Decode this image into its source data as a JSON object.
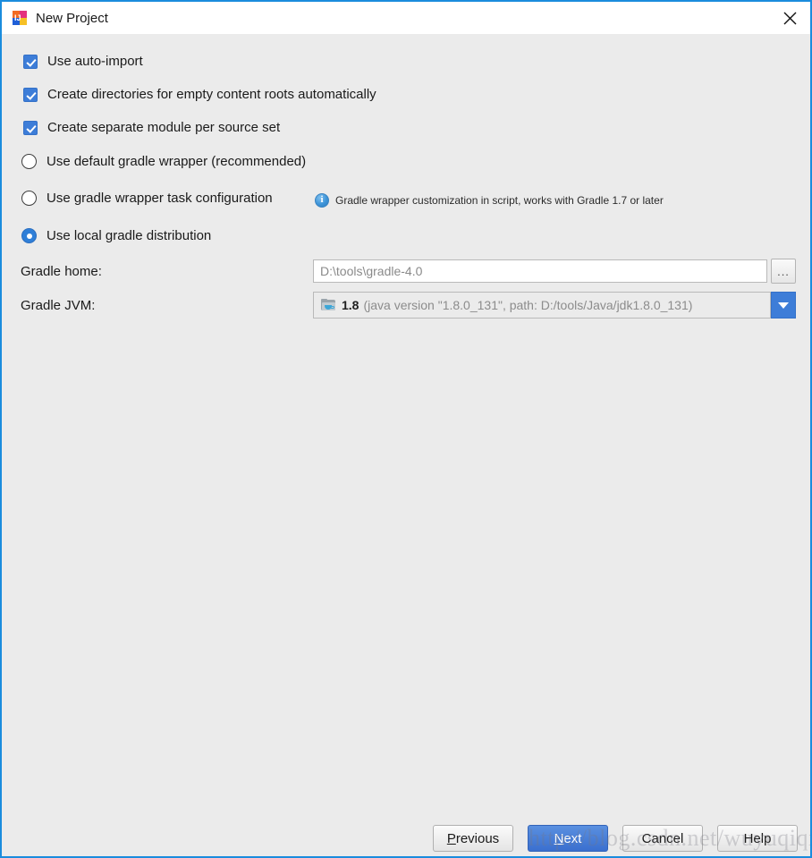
{
  "window": {
    "title": "New Project",
    "app_icon": "intellij-idea-icon",
    "close_icon": "close-icon",
    "border_color": "#1a8cdd",
    "titlebar_bg": "#ffffff",
    "content_bg": "#ebebeb"
  },
  "options": {
    "checkboxes": [
      {
        "label": "Use auto-import",
        "checked": true
      },
      {
        "label": "Create directories for empty content roots automatically",
        "checked": true
      },
      {
        "label": "Create separate module per source set",
        "checked": true
      }
    ],
    "radios": [
      {
        "label": "Use default gradle wrapper (recommended)",
        "selected": false
      },
      {
        "label": "Use gradle wrapper task configuration",
        "selected": false
      },
      {
        "label": "Use local gradle distribution",
        "selected": true
      }
    ],
    "hint": {
      "icon": "info-icon",
      "text": "Gradle wrapper customization in script, works with Gradle 1.7 or later"
    }
  },
  "fields": {
    "gradle_home": {
      "label": "Gradle home:",
      "value": "D:\\tools\\gradle-4.0",
      "browse_label": "..."
    },
    "gradle_jvm": {
      "label": "Gradle JVM:",
      "icon": "jdk-folder-icon",
      "version": "1.8",
      "detail": "(java version \"1.8.0_131\", path: D:/tools/Java/jdk1.8.0_131)",
      "arrow_icon": "chevron-down-icon"
    }
  },
  "footer": {
    "previous": {
      "prefix": "",
      "mnemonic": "P",
      "suffix": "revious"
    },
    "next": {
      "prefix": "",
      "mnemonic": "N",
      "suffix": "ext"
    },
    "cancel": {
      "label": "Cancel"
    },
    "help": {
      "label": "Help"
    },
    "accent_color": "#3d7dd8"
  },
  "watermark": {
    "text": "http://blog.csdn.net/wuyuqiqiu"
  }
}
